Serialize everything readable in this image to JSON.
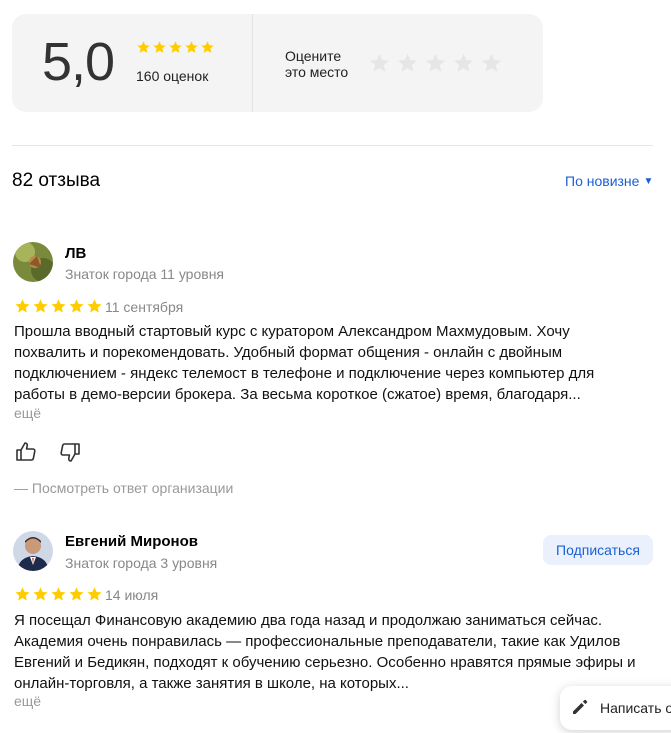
{
  "summary": {
    "score": "5,0",
    "stars_filled": 5,
    "ratings_count": "160 оценок",
    "rate_prompt_line1": "Оцените",
    "rate_prompt_line2": "это место",
    "star_color": "#fc0",
    "empty_star_color": "#e6e6e6"
  },
  "reviews_header": {
    "count_label": "82 отзыва",
    "sort_label": "По новизне",
    "sort_icon": "chevron-down-icon",
    "link_color": "#1a5fd6"
  },
  "reviews": [
    {
      "author": "ЛВ",
      "level": "Знаток города 11 уровня",
      "rating": 5,
      "date": "11 сентября",
      "text": "Прошла вводный стартовый курс с куратором Александром Махмудовым. Хочу похвалить и порекомендовать. Удобный формат общения - онлайн с двойным подключением - яндекс телемост в телефоне и подключение через компьютер для работы в демо-версии брокера. За весьма короткое (сжатое) время, благодаря...",
      "more": "ещё",
      "org_answer": "— Посмотреть ответ организации"
    },
    {
      "author": "Евгений Миронов",
      "level": "Знаток города 3 уровня",
      "rating": 5,
      "date": "14 июля",
      "subscribe": "Подписаться",
      "text": "Я посещал Финансовую академию два года назад и продолжаю заниматься сейчас. Академия очень понравилась — профессиональные преподаватели, такие как Удилов Евгений и Бедикян, подходят к обучению серьезно. Особенно нравятся прямые эфиры и онлайн-торговля, а также занятия в школе, на которых...",
      "more": "ещё"
    }
  ],
  "write_review": {
    "label": "Написать о",
    "icon": "pencil-icon"
  }
}
